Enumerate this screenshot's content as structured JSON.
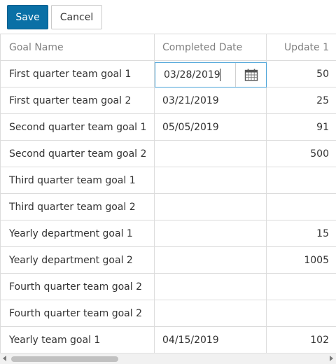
{
  "toolbar": {
    "save_label": "Save",
    "cancel_label": "Cancel"
  },
  "grid": {
    "columns": [
      "Goal Name",
      "Completed Date",
      "Update 1"
    ],
    "editor": {
      "value": "03/28/2019",
      "icon": "calendar-icon"
    },
    "rows": [
      {
        "goal": "First quarter team goal 1",
        "date": "",
        "update": "50"
      },
      {
        "goal": "First quarter team goal 2",
        "date": "03/21/2019",
        "update": "25"
      },
      {
        "goal": "Second quarter team goal 1",
        "date": "05/05/2019",
        "update": "91"
      },
      {
        "goal": "Second quarter team goal 2",
        "date": "",
        "update": "500"
      },
      {
        "goal": "Third quarter team goal 1",
        "date": "",
        "update": ""
      },
      {
        "goal": "Third quarter team goal 2",
        "date": "",
        "update": ""
      },
      {
        "goal": "Yearly department goal 1",
        "date": "",
        "update": "15"
      },
      {
        "goal": "Yearly department goal 2",
        "date": "",
        "update": "1005"
      },
      {
        "goal": "Fourth quarter team goal 2",
        "date": "",
        "update": ""
      },
      {
        "goal": "Fourth quarter team goal 2",
        "date": "",
        "update": ""
      },
      {
        "goal": "Yearly team goal 1",
        "date": "04/15/2019",
        "update": "102"
      }
    ]
  },
  "colors": {
    "primary": "#0a70a6",
    "focus_border": "#4aa3d8",
    "grid_line": "#dcdcdc"
  }
}
